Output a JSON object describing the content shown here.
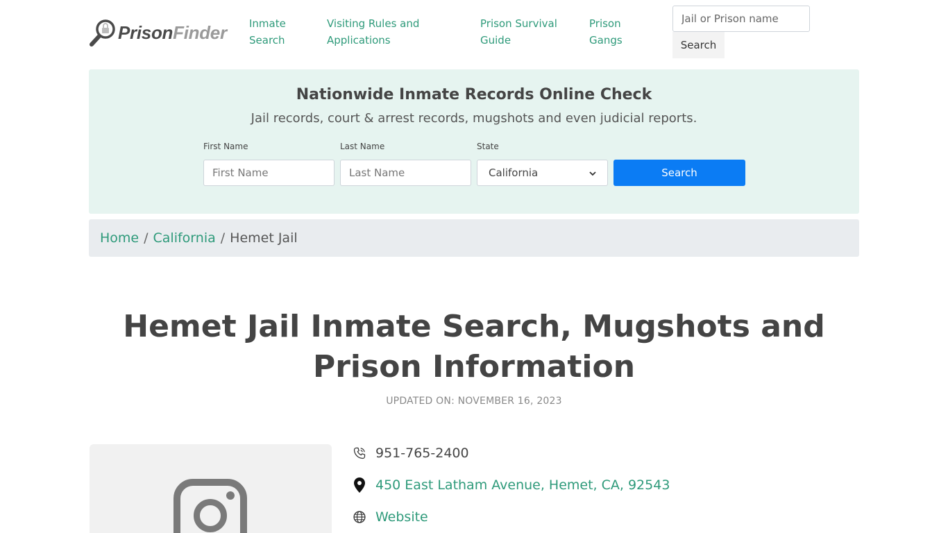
{
  "header": {
    "logo": {
      "part1": "Prison",
      "part2": "Finder"
    },
    "nav": [
      {
        "line1": "Inmate",
        "line2": "Search"
      },
      {
        "line1": "Visiting Rules and",
        "line2": "Applications"
      },
      {
        "line1": "Prison Survival",
        "line2": "Guide"
      },
      {
        "line1": "Prison",
        "line2": "Gangs"
      }
    ],
    "search": {
      "placeholder": "Jail or Prison name",
      "button": "Search"
    }
  },
  "banner": {
    "title": "Nationwide Inmate Records Online Check",
    "subtitle": "Jail records, court & arrest records, mugshots and even judicial reports.",
    "first_name": {
      "label": "First Name",
      "placeholder": "First Name"
    },
    "last_name": {
      "label": "Last Name",
      "placeholder": "Last Name"
    },
    "state": {
      "label": "State",
      "selected": "California"
    },
    "button": "Search"
  },
  "breadcrumb": {
    "home": "Home",
    "state": "California",
    "current": "Hemet Jail",
    "separator": "/"
  },
  "page": {
    "title": "Hemet Jail Inmate Search, Mugshots and Prison Information",
    "updated": "UPDATED ON: NOVEMBER 16, 2023"
  },
  "info": {
    "phone": "951-765-2400",
    "address": "450 East Latham Avenue, Hemet, CA, 92543",
    "website": "Website"
  },
  "colors": {
    "accent": "#2e9a7a",
    "banner_bg": "#e6f4f0",
    "primary_button": "#0b7cf4",
    "breadcrumb_bg": "#e9ecef"
  },
  "icons": [
    "magnifier-lock-logo-icon",
    "phone-icon",
    "map-pin-icon",
    "globe-icon",
    "instagram-icon",
    "chevron-down-icon"
  ]
}
